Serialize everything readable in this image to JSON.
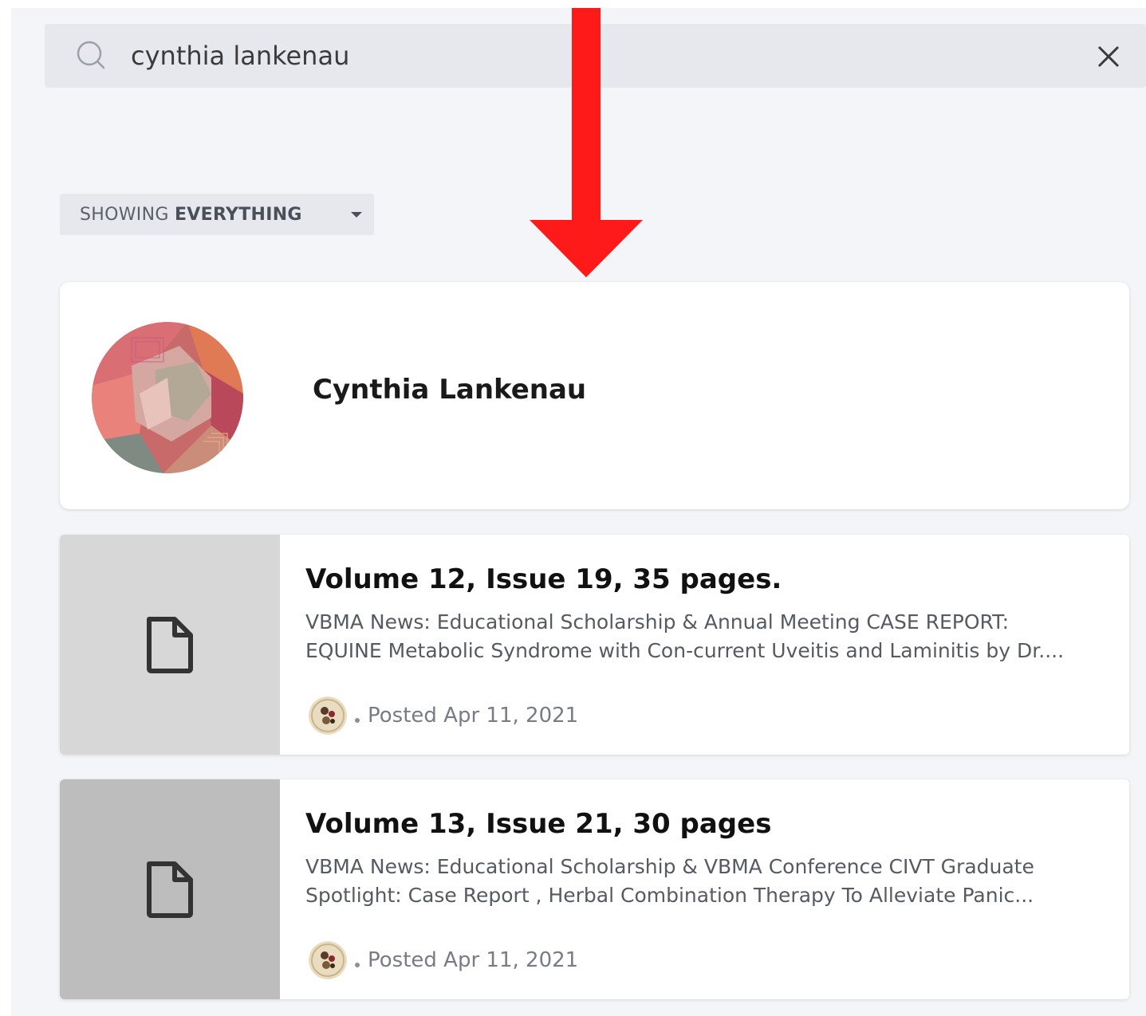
{
  "search": {
    "value": "cynthia lankenau",
    "placeholder": ""
  },
  "filter": {
    "prefix": "SHOWING ",
    "selected": "EVERYTHING"
  },
  "person_result": {
    "name": "Cynthia Lankenau"
  },
  "document_results": [
    {
      "title": "Volume 12, Issue 19, 35 pages.",
      "excerpt_lines": [
        "VBMA News: Educational Scholarship & Annual Meeting CASE REPORT:",
        "EQUINE  Metabolic Syndrome with Con-current Uveitis and Laminitis by Dr...."
      ],
      "posted": "Posted Apr 11, 2021",
      "thumb_color": "#d7d7d7"
    },
    {
      "title": "Volume 13, Issue 21, 30 pages",
      "excerpt_lines": [
        "VBMA News:  Educational Scholarship & VBMA Conference CIVT Graduate",
        "Spotlight:  Case Report , Herbal Combination Therapy To Alleviate Panic..."
      ],
      "posted": "Posted Apr 11, 2021",
      "thumb_color": "#bdbdbd"
    }
  ],
  "icons": {
    "search": "search-icon",
    "close": "close-icon",
    "file": "file-icon",
    "caret": "chevron-down-icon",
    "annotation": "red-arrow-down-icon"
  },
  "colors": {
    "panel_bg": "#f4f5f8",
    "search_bg": "#e6e8ed",
    "annotation_red": "#ff1a1a"
  }
}
